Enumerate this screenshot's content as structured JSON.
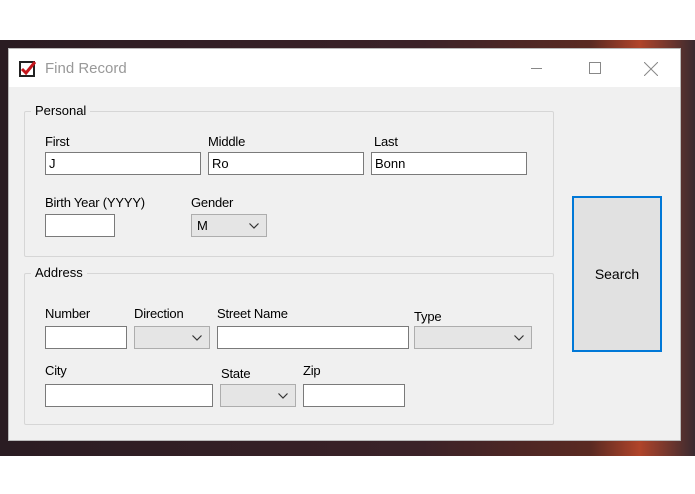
{
  "window": {
    "title": "Find Record",
    "icon": "checkbox-checked-icon",
    "accent_color": "#0078d7",
    "icon_color": "#c4161c"
  },
  "personal": {
    "legend": "Personal",
    "first_label": "First",
    "first_value": "J",
    "middle_label": "Middle",
    "middle_value": "Ro",
    "last_label": "Last",
    "last_value": "Bonn",
    "birth_year_label": "Birth Year (YYYY)",
    "birth_year_value": "",
    "gender_label": "Gender",
    "gender_value": "M"
  },
  "address": {
    "legend": "Address",
    "number_label": "Number",
    "number_value": "",
    "direction_label": "Direction",
    "direction_value": "",
    "street_label": "Street Name",
    "street_value": "",
    "type_label": "Type",
    "type_value": "",
    "city_label": "City",
    "city_value": "",
    "state_label": "State",
    "state_value": "",
    "zip_label": "Zip",
    "zip_value": ""
  },
  "actions": {
    "search_label": "Search"
  }
}
